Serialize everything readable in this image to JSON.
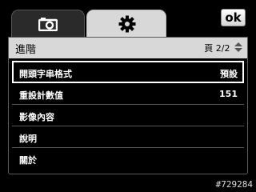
{
  "tabs": [
    {
      "name": "camera",
      "icon": "camera-icon"
    },
    {
      "name": "settings",
      "icon": "gear-icon",
      "active": true
    }
  ],
  "ok_label": "ok",
  "panel": {
    "title": "進階",
    "page_indicator": "頁 2/2"
  },
  "menu": {
    "items": [
      {
        "label": "開頭字串格式",
        "value": "預設",
        "selected": true
      },
      {
        "label": "重設計數值",
        "value": "151"
      },
      {
        "label": "影像內容",
        "value": ""
      },
      {
        "label": "說明",
        "value": ""
      },
      {
        "label": "關於",
        "value": ""
      }
    ]
  },
  "footer_id": "#729284",
  "colors": {
    "header_bg": "#d8d8d8",
    "panel_bg": "#000000",
    "text": "#ffffff"
  }
}
